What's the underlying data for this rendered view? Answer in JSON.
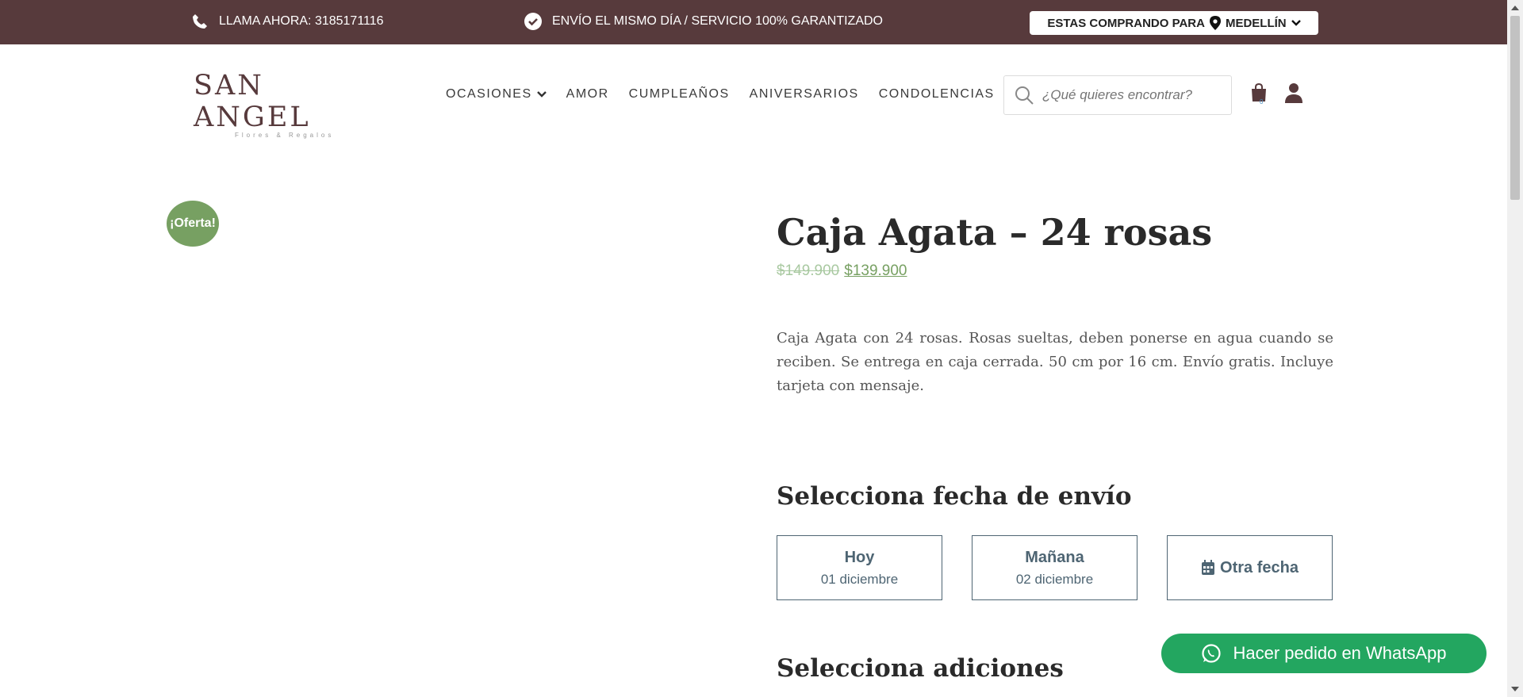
{
  "topbar": {
    "call_text": "LLAMA AHORA: 3185171116",
    "shipping_text": "ENVÍO EL MISMO DÍA / SERVICIO 100% GARANTIZADO",
    "city_prefix": "ESTAS COMPRANDO PARA",
    "city": "MEDELLÍN",
    "bg_color": "#573a3c"
  },
  "header": {
    "logo_word": "SAN ANGEL",
    "logo_tagline": "Flores & Regalos",
    "nav": [
      {
        "label": "OCASIONES",
        "dropdown": true
      },
      {
        "label": "AMOR"
      },
      {
        "label": "CUMPLEAÑOS"
      },
      {
        "label": "ANIVERSARIOS"
      },
      {
        "label": "CONDOLENCIAS"
      }
    ],
    "search_placeholder": "¿Qué quieres encontrar?",
    "cart_count": "0"
  },
  "product": {
    "badge": "¡Oferta!",
    "title": "Caja Agata – 24 rosas",
    "old_price": "$149.900",
    "price": "$139.900",
    "description": "Caja Agata con 24 rosas. Rosas sueltas, deben ponerse en agua cuando se reciben. Se entrega en caja cerrada. 50 cm por 16 cm. Envío gratis. Incluye tarjeta con mensaje."
  },
  "delivery": {
    "title": "Selecciona fecha de envío",
    "options": [
      {
        "label": "Hoy",
        "date": "01 diciembre"
      },
      {
        "label": "Mañana",
        "date": "02 diciembre"
      },
      {
        "label": "Otra fecha"
      }
    ]
  },
  "addons": {
    "title": "Selecciona adiciones"
  },
  "whatsapp": {
    "label": "Hacer pedido en WhatsApp",
    "color": "#23a660"
  },
  "colors": {
    "accent_green": "#77a062",
    "brand_brown": "#573a3c",
    "date_border": "#4e6573"
  }
}
